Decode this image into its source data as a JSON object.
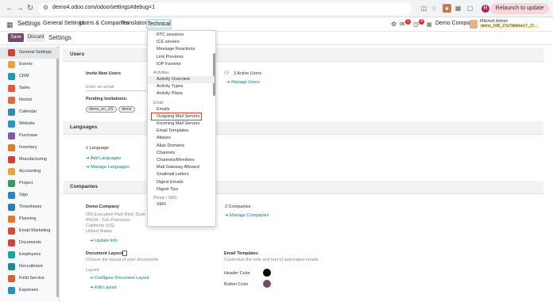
{
  "browser": {
    "url": "demo4.odoo.com/odoo/settings#debug=1",
    "relaunch_label": "Relaunch to update",
    "profile_initial": "R"
  },
  "navbar": {
    "app_title": "Settings",
    "menu": [
      "General Settings",
      "Users & Companies",
      "Translations",
      "Technical"
    ],
    "badge_activity": "1",
    "badge_clock": "4",
    "company": "Demo Company",
    "user_name": "Mitchell Admin",
    "user_db": "demo_16B_27a79bbfee17_17..."
  },
  "control_panel": {
    "save_label": "Save",
    "discard_label": "Discard",
    "title": "Settings"
  },
  "sidebar": {
    "items": [
      {
        "label": "General Settings",
        "color": "#d0413c"
      },
      {
        "label": "Events",
        "color": "#e8a33a"
      },
      {
        "label": "CRM",
        "color": "#1f9ca6"
      },
      {
        "label": "Sales",
        "color": "#e9573f"
      },
      {
        "label": "Rental",
        "color": "#e06b3a"
      },
      {
        "label": "Calendar",
        "color": "#2e8bb0"
      },
      {
        "label": "Website",
        "color": "#2d98b8"
      },
      {
        "label": "Purchase",
        "color": "#7c5ba6"
      },
      {
        "label": "Inventory",
        "color": "#e37c2d"
      },
      {
        "label": "Manufacturing",
        "color": "#d0413c"
      },
      {
        "label": "Accounting",
        "color": "#e0a93a"
      },
      {
        "label": "Project",
        "color": "#2f9c5a"
      },
      {
        "label": "Sign",
        "color": "#2b86c5"
      },
      {
        "label": "Timesheets",
        "color": "#2b7fb0"
      },
      {
        "label": "Planning",
        "color": "#e07a2e"
      },
      {
        "label": "Email Marketing",
        "color": "#d64c37"
      },
      {
        "label": "Documents",
        "color": "#d2453c"
      },
      {
        "label": "Employees",
        "color": "#1e9fa5"
      },
      {
        "label": "Recruitment",
        "color": "#1c8c94"
      },
      {
        "label": "Field Service",
        "color": "#e05d30"
      },
      {
        "label": "Expenses",
        "color": "#2d8fbf"
      }
    ]
  },
  "users": {
    "section_title": "Users",
    "invite_label": "Invite New Users",
    "email_placeholder": "Enter an email",
    "invite_button": "Invite",
    "pending_label": "Pending Invitations:",
    "pending": [
      "demo_en_US",
      "demo"
    ],
    "active_users": "3 Active Users",
    "manage_users": "Manage Users"
  },
  "languages": {
    "section_title": "Languages",
    "count": "1 Language",
    "add": "Add Languages",
    "manage": "Manage Languages"
  },
  "companies": {
    "section_title": "Companies",
    "company_name": "Demo Company",
    "address_1": "250 Executive Park Blvd, Suite 34",
    "address_2": "94134 - San Francisco",
    "address_3": "California (US)",
    "address_4": "United States",
    "update_info": "Update Info",
    "count": "2 Companies",
    "manage": "Manage Companies",
    "doc_layout_title": "Document Layout",
    "doc_layout_desc": "Choose the layout of your documents",
    "layout_label": "Layout",
    "configure_layout": "Configure Document Layout",
    "edit_layout": "Edit Layout",
    "email_templates_title": "Email Templates",
    "email_templates_desc": "Customize the look and feel of automated emails",
    "header_color_label": "Header Color",
    "button_color_label": "Button Color",
    "header_color": "#000000",
    "button_color": "#714b67"
  },
  "technical_menu": {
    "top_items": [
      "RTC sessions",
      "ICE servers",
      "Message Reactions",
      "Link Previews",
      "IOP Favorite"
    ],
    "activities_header": "Activities",
    "activities": [
      "Activity Overview",
      "Activity Types",
      "Activity Plans"
    ],
    "email_header": "Email",
    "email_items": [
      "Emails",
      "Outgoing Mail Servers",
      "Incoming Mail Servers",
      "Email Templates",
      "Aliases",
      "Alias Domains",
      "Channels",
      "Channels/Members",
      "Mail Gateway Allowed",
      "Snailmail Letters",
      "Digest Emails",
      "Digest Tips"
    ],
    "phone_header": "Phone / SMS",
    "phone_items": [
      "SMS"
    ],
    "highlighted": "Outgoing Mail Servers"
  }
}
